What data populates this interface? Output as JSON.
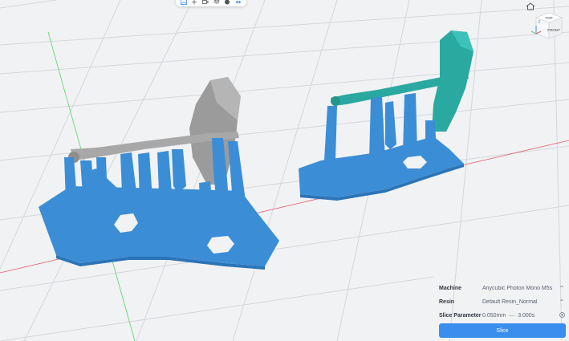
{
  "toolbar": {
    "tools": [
      "image-icon",
      "translate-icon",
      "camera-icon",
      "layers-icon",
      "sphere-icon",
      "eye-icon"
    ]
  },
  "view_cube": {
    "top_label": "TOP",
    "front_label": "FRONT",
    "axis_label": "Z"
  },
  "settings": {
    "machine_label": "Machine",
    "machine_value": "Anycubic Photon Mono M5s",
    "resin_label": "Resin",
    "resin_value": "Default Resin_Normal",
    "param_label": "Slice Parameter",
    "param_min": "0.050mm",
    "param_max": "3.000s",
    "param_separator": "—"
  },
  "actions": {
    "slice_label": "Slice"
  },
  "colors": {
    "accent": "#3a8eee",
    "support_blue": "#3b8ed6",
    "model_gray": "#9a9a9a",
    "model_teal": "#2aa9a0",
    "grid_line": "#d4d7db",
    "axis_red": "#e05a6a",
    "axis_green": "#5ad06a"
  }
}
